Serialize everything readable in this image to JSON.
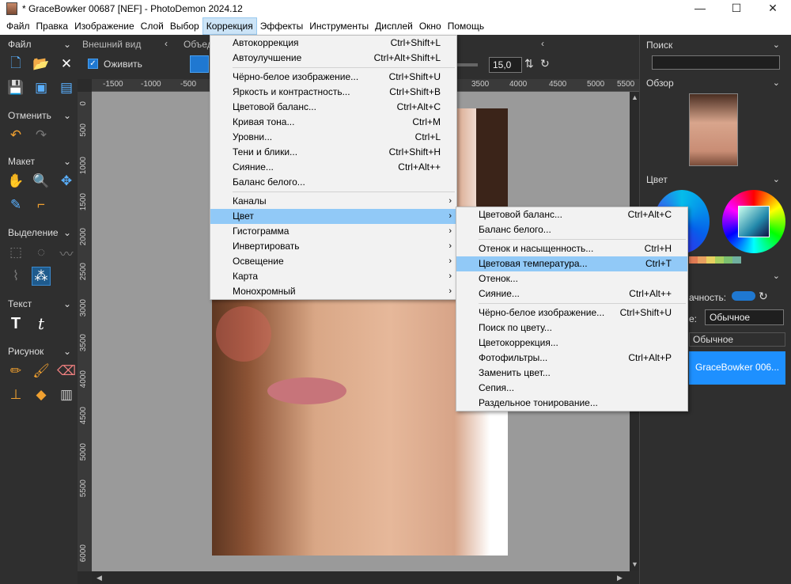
{
  "window": {
    "title": "* GraceBowker 00687 [NEF]  -  PhotoDemon 2024.12",
    "controls": [
      "—",
      "☐",
      "✕"
    ]
  },
  "menubar": {
    "items": [
      "Файл",
      "Правка",
      "Изображение",
      "Слой",
      "Выбор",
      "Коррекция",
      "Эффекты",
      "Инструменты",
      "Дисплей",
      "Окно",
      "Помощь"
    ],
    "active": "Коррекция"
  },
  "toolbox": {
    "sections": {
      "file": "Файл",
      "undo": "Отменить",
      "layout": "Макет",
      "selection": "Выделение",
      "text": "Текст",
      "paint": "Рисунок"
    }
  },
  "options": {
    "appearance_label": "Внешний вид",
    "animate_label": "Оживить",
    "object_label": "Объед",
    "value": "15,0"
  },
  "rulers": {
    "h": [
      "-1500",
      "-1000",
      "-500",
      "0",
      "3500",
      "4000",
      "4500",
      "5000",
      "5500"
    ],
    "v": [
      "0",
      "500",
      "1000",
      "1500",
      "2000",
      "2500",
      "3000",
      "3500",
      "4000",
      "4500",
      "5000",
      "5500",
      "6000"
    ]
  },
  "right_panel": {
    "search_title": "Поиск",
    "overview_title": "Обзор",
    "color_title": "Цвет",
    "opacity_label": "ачность:",
    "blend_label": "е:",
    "blend_value": "Обычное",
    "blend_value2": "Обычное",
    "layer_name": "GraceBowker 006...",
    "swatches": [
      "#e07b54",
      "#e8a060",
      "#e8d060",
      "#a8d060",
      "#7cc070",
      "#70b0a0"
    ]
  },
  "correction_menu": {
    "items": [
      {
        "label": "Автокоррекция",
        "shortcut": "Ctrl+Shift+L"
      },
      {
        "label": "Автоулучшение",
        "shortcut": "Ctrl+Alt+Shift+L"
      },
      {
        "sep": true
      },
      {
        "label": "Чёрно-белое изображение...",
        "shortcut": "Ctrl+Shift+U"
      },
      {
        "label": "Яркость и контрастность...",
        "shortcut": "Ctrl+Shift+B"
      },
      {
        "label": "Цветовой баланс...",
        "shortcut": "Ctrl+Alt+C"
      },
      {
        "label": "Кривая тона...",
        "shortcut": "Ctrl+M"
      },
      {
        "label": "Уровни...",
        "shortcut": "Ctrl+L"
      },
      {
        "label": "Тени и блики...",
        "shortcut": "Ctrl+Shift+H"
      },
      {
        "label": "Сияние...",
        "shortcut": "Ctrl+Alt++"
      },
      {
        "label": "Баланс белого...",
        "shortcut": ""
      },
      {
        "sep": true
      },
      {
        "label": "Каналы",
        "submenu": true
      },
      {
        "label": "Цвет",
        "submenu": true,
        "highlight": true
      },
      {
        "label": "Гистограмма",
        "submenu": true
      },
      {
        "label": "Инвертировать",
        "submenu": true
      },
      {
        "label": "Освещение",
        "submenu": true
      },
      {
        "label": "Карта",
        "submenu": true
      },
      {
        "label": "Монохромный",
        "submenu": true
      }
    ]
  },
  "color_submenu": {
    "items": [
      {
        "label": "Цветовой баланс...",
        "shortcut": "Ctrl+Alt+C"
      },
      {
        "label": "Баланс белого...",
        "shortcut": ""
      },
      {
        "sep": true
      },
      {
        "label": "Отенок и насыщенность...",
        "shortcut": "Ctrl+H"
      },
      {
        "label": "Цветовая температура...",
        "shortcut": "Ctrl+T",
        "highlight": true
      },
      {
        "label": "Отенок...",
        "shortcut": ""
      },
      {
        "label": "Сияние...",
        "shortcut": "Ctrl+Alt++"
      },
      {
        "sep": true
      },
      {
        "label": "Чёрно-белое изображение...",
        "shortcut": "Ctrl+Shift+U"
      },
      {
        "label": "Поиск по цвету...",
        "shortcut": ""
      },
      {
        "label": "Цветокоррекция...",
        "shortcut": ""
      },
      {
        "label": "Фотофильтры...",
        "shortcut": "Ctrl+Alt+P"
      },
      {
        "label": "Заменить цвет...",
        "shortcut": ""
      },
      {
        "label": "Сепия...",
        "shortcut": ""
      },
      {
        "label": "Раздельное тонирование...",
        "shortcut": ""
      }
    ]
  }
}
